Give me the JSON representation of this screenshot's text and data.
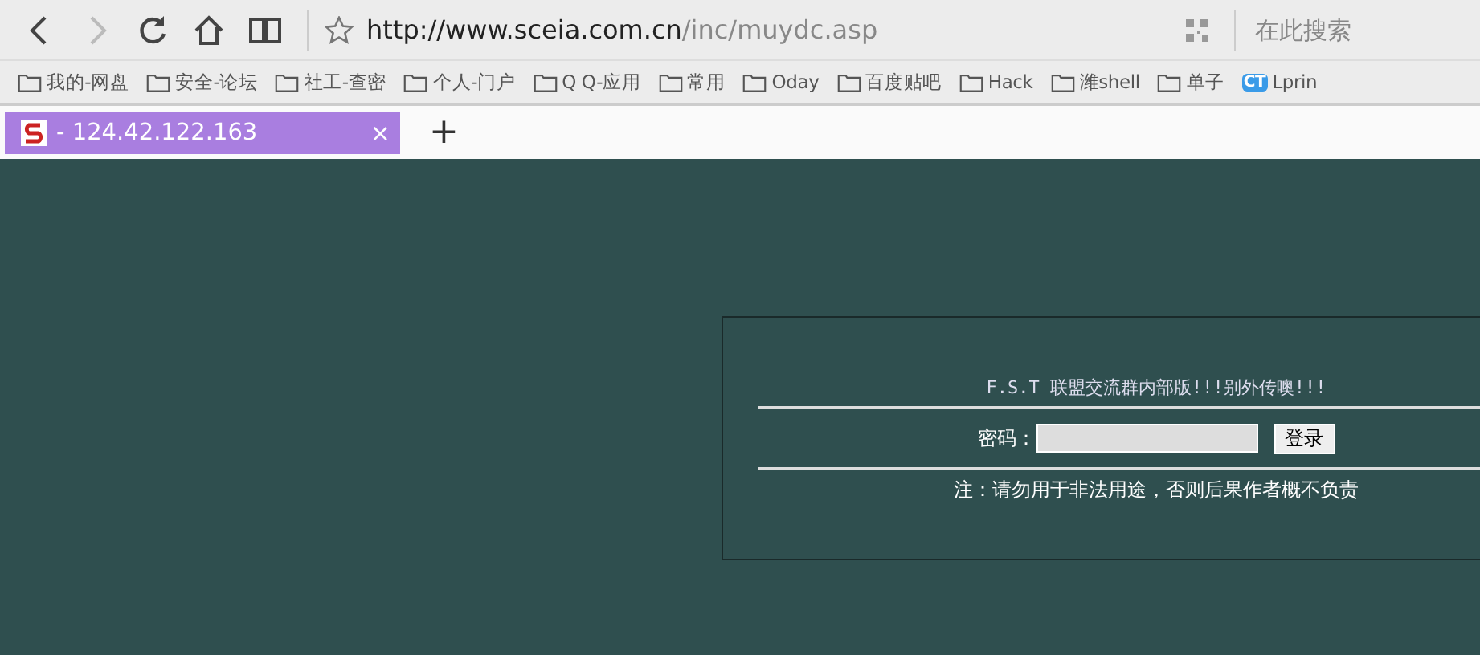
{
  "toolbar": {
    "back_disabled": false,
    "forward_disabled": true
  },
  "address": {
    "host": "http://www.sceia.com.cn",
    "path": "/inc/muydc.asp"
  },
  "search": {
    "placeholder": "在此搜索"
  },
  "bookmarks": [
    {
      "kind": "folder",
      "label": "我的-网盘"
    },
    {
      "kind": "folder",
      "label": "安全-论坛"
    },
    {
      "kind": "folder",
      "label": "社工-查密"
    },
    {
      "kind": "folder",
      "label": "个人-门户"
    },
    {
      "kind": "folder",
      "label": "Q Q-应用"
    },
    {
      "kind": "folder",
      "label": "常用"
    },
    {
      "kind": "folder",
      "label": "Oday"
    },
    {
      "kind": "folder",
      "label": "百度贴吧"
    },
    {
      "kind": "folder",
      "label": "Hack"
    },
    {
      "kind": "folder",
      "label": "潍shell"
    },
    {
      "kind": "folder",
      "label": "单子"
    },
    {
      "kind": "app",
      "badge": "CT",
      "label": "Lprin"
    }
  ],
  "tabs": [
    {
      "title": "- 124.42.122.163",
      "close": "×",
      "selected": true
    }
  ],
  "new_tab": "+",
  "page": {
    "heading": "F.S.T 联盟交流群内部版!!!别外传噢!!!",
    "password_label": "密码：",
    "login_button": "登录",
    "note": "注：请勿用于非法用途，否则后果作者概不负责"
  }
}
